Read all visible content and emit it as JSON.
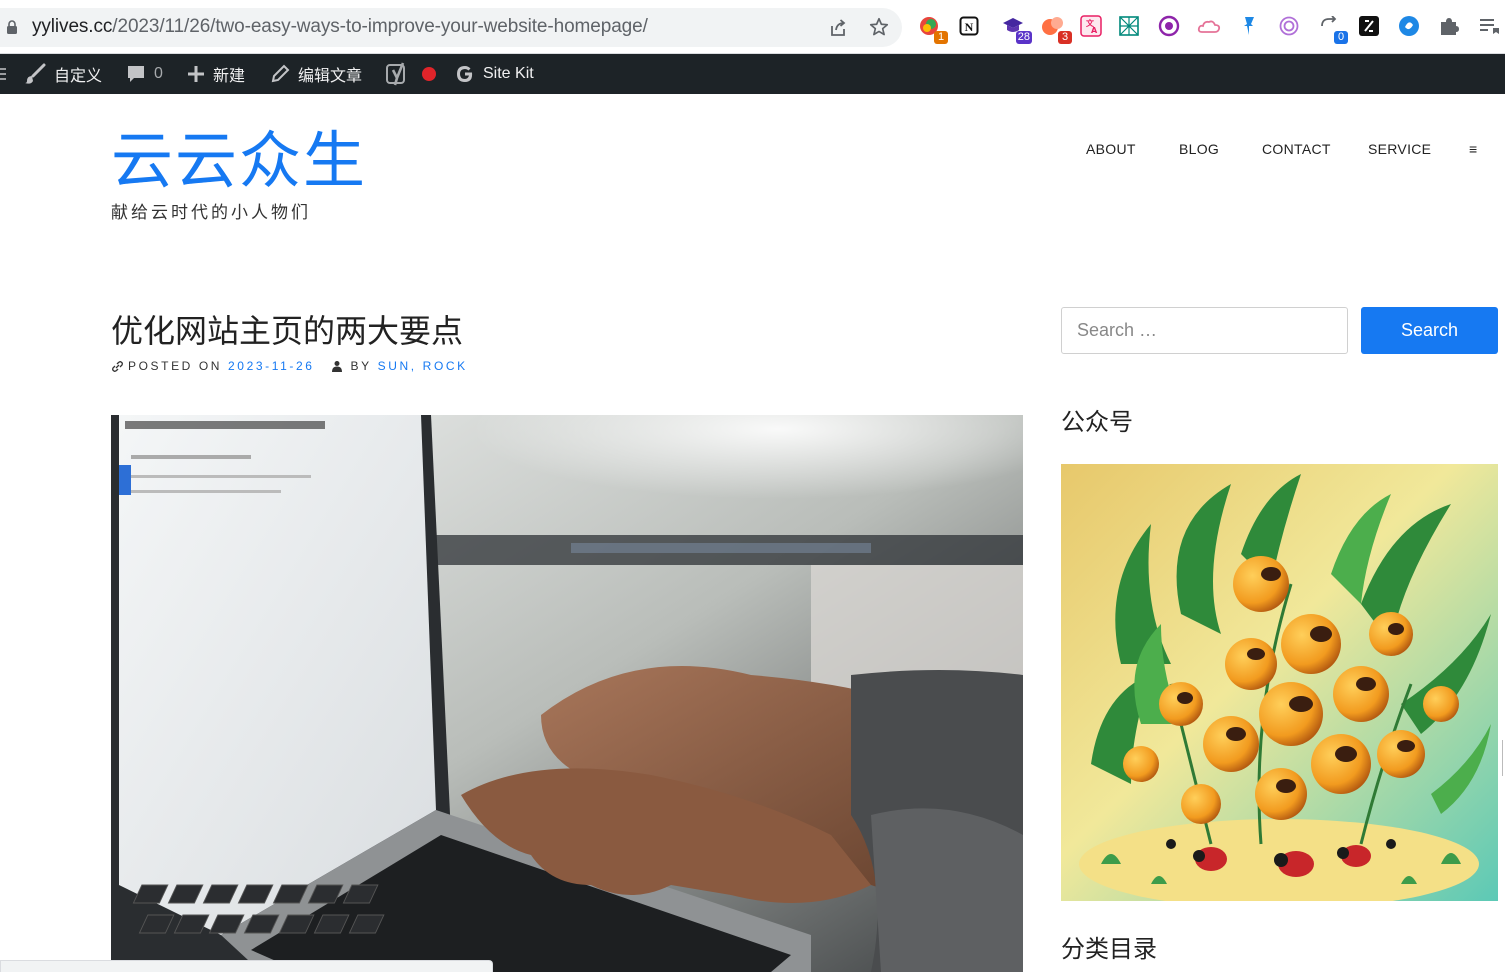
{
  "browser": {
    "url_host": "yylives.cc",
    "url_path": "/2023/11/26/two-easy-ways-to-improve-your-website-homepage/",
    "extensions": [
      {
        "icon": "colorful-circle-extension-icon",
        "badge": "1",
        "badge_color": "#e37400"
      },
      {
        "icon": "notion-icon",
        "badge": ""
      },
      {
        "icon": "graduation-cap-icon",
        "badge": "28",
        "badge_color": "#5a33c8"
      },
      {
        "icon": "orange-bubbles-icon",
        "badge": "3",
        "badge_color": "#d93025"
      },
      {
        "icon": "translate-icon",
        "badge": ""
      },
      {
        "icon": "teal-grid-icon",
        "badge": ""
      },
      {
        "icon": "purple-circle-icon",
        "badge": ""
      },
      {
        "icon": "pink-cloud-icon",
        "badge": ""
      },
      {
        "icon": "blue-pin-icon",
        "badge": ""
      },
      {
        "icon": "openai-icon",
        "badge": ""
      },
      {
        "icon": "sync-icon",
        "badge": "0",
        "badge_color": "#1a73e8"
      },
      {
        "icon": "dark-square-icon",
        "badge": ""
      },
      {
        "icon": "blue-circle-icon",
        "badge": ""
      },
      {
        "icon": "puzzle-icon",
        "badge": ""
      },
      {
        "icon": "reading-list-icon",
        "badge": ""
      }
    ]
  },
  "admin_bar": {
    "customize": "自定义",
    "comments_count": "0",
    "new": "新建",
    "edit_post": "编辑文章",
    "site_kit": "Site Kit"
  },
  "site": {
    "title": "云云众生",
    "tagline": "献给云时代的小人物们"
  },
  "nav": {
    "items": [
      "ABOUT",
      "BLOG",
      "CONTACT",
      "SERVICE"
    ],
    "menu_glyph": "≡"
  },
  "post": {
    "title": "优化网站主页的两大要点",
    "posted_on_label": "POSTED ON",
    "date": "2023-11-26",
    "by_label": "BY",
    "author": "SUN, ROCK"
  },
  "sidebar": {
    "search_placeholder": "Search …",
    "search_button": "Search",
    "widget_wechat_title": "公众号",
    "widget_categories_title": "分类目录"
  },
  "colors": {
    "accent": "#1679f2",
    "admin_bar_bg": "#1d2327"
  }
}
